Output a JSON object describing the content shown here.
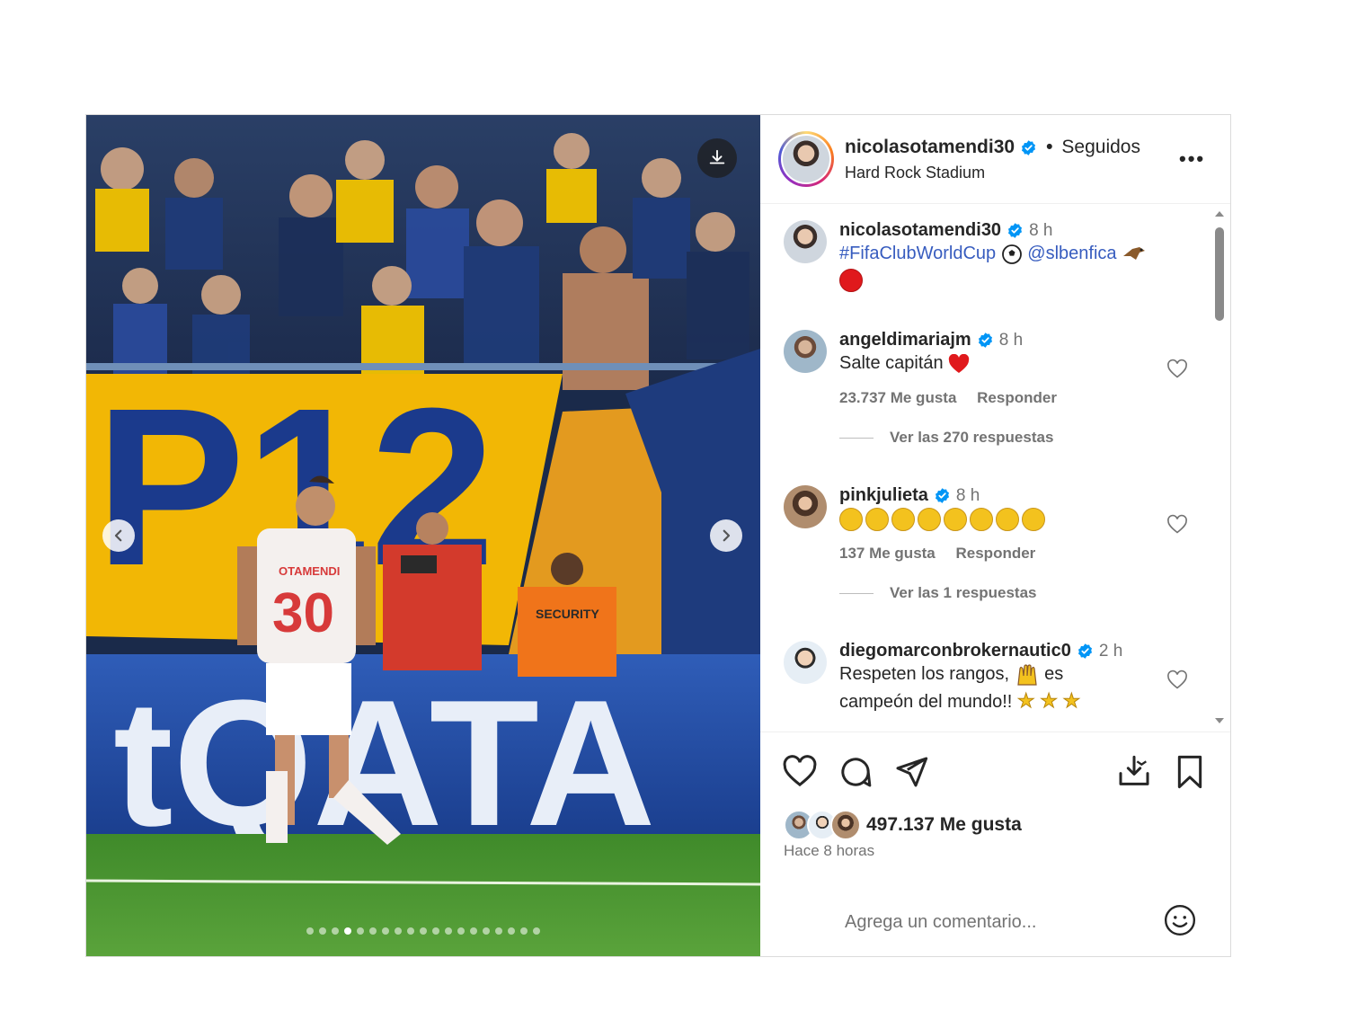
{
  "post": {
    "author": {
      "username": "nicolasotamendi30",
      "follow_status": "Seguidos",
      "separator": "•",
      "location": "Hard Rock Stadium"
    },
    "more_label": "•••",
    "media": {
      "carousel_total": 19,
      "carousel_active_index": 3
    },
    "caption": {
      "username": "nicolasotamendi30",
      "time": "8 h",
      "hashtag": "#FifaClubWorldCup",
      "mention": "@slbenfica"
    },
    "comments": [
      {
        "username": "angeldimariajm",
        "verified": true,
        "time": "8 h",
        "text": "Salte capitán",
        "likes": "23.737 Me gusta",
        "reply_label": "Responder",
        "view_replies": "Ver las 270 respuestas"
      },
      {
        "username": "pinkjulieta",
        "verified": true,
        "time": "8 h",
        "likes": "137 Me gusta",
        "reply_label": "Responder",
        "view_replies": "Ver las 1 respuestas"
      },
      {
        "username": "diegomarconbrokernautic0",
        "verified": true,
        "time": "2 h",
        "text_line1": "Respeten los rangos,",
        "text_line1_end": "es",
        "text_line2": "campeón del mundo!!"
      }
    ],
    "actions": {
      "likes": "497.137 Me gusta",
      "posted_ago": "Hace 8 horas",
      "comment_placeholder": "Agrega un comentario..."
    }
  },
  "colors": {
    "link": "#375cbf",
    "verified": "#0095f6",
    "text": "#262626",
    "secondary": "#737373"
  },
  "icons": [
    "download-icon",
    "chevron-left-icon",
    "chevron-right-icon",
    "verified-icon",
    "more-icon",
    "heart-icon",
    "comment-icon",
    "share-icon",
    "save-to-device-icon",
    "bookmark-icon",
    "emoji-icon"
  ]
}
